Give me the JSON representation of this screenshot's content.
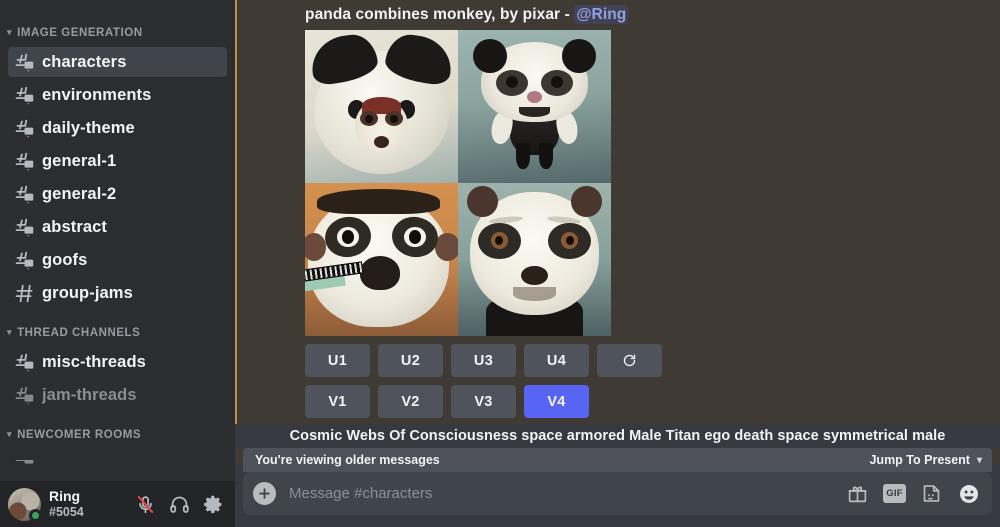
{
  "sidebar": {
    "categories": [
      {
        "label": "IMAGE GENERATION",
        "channels": [
          {
            "name": "characters",
            "icon": "forum-hash-icon",
            "state": "active"
          },
          {
            "name": "environments",
            "icon": "forum-hash-icon",
            "state": "unread"
          },
          {
            "name": "daily-theme",
            "icon": "forum-hash-icon",
            "state": "unread"
          },
          {
            "name": "general-1",
            "icon": "forum-hash-icon",
            "state": "unread"
          },
          {
            "name": "general-2",
            "icon": "forum-hash-icon",
            "state": "unread"
          },
          {
            "name": "abstract",
            "icon": "forum-hash-icon",
            "state": "unread"
          },
          {
            "name": "goofs",
            "icon": "forum-hash-icon",
            "state": "unread"
          },
          {
            "name": "group-jams",
            "icon": "hash-icon",
            "state": "unread"
          }
        ]
      },
      {
        "label": "THREAD CHANNELS",
        "channels": [
          {
            "name": "misc-threads",
            "icon": "forum-hash-icon",
            "state": "unread"
          },
          {
            "name": "jam-threads",
            "icon": "forum-hash-icon",
            "state": "dim"
          }
        ]
      },
      {
        "label": "NEWCOMER ROOMS",
        "channels": []
      }
    ],
    "user": {
      "name": "Ring",
      "tag": "#5054",
      "status": "online",
      "controls": [
        {
          "icon": "microphone-muted-icon",
          "label": "Mute"
        },
        {
          "icon": "headphones-icon",
          "label": "Deafen"
        },
        {
          "icon": "gear-icon",
          "label": "User Settings"
        }
      ]
    }
  },
  "message": {
    "prompt_title": "panda combines monkey, by pixar",
    "separator": "-",
    "mention": "@Ring",
    "image_grid": {
      "rows": 2,
      "cols": 2,
      "tiles": [
        {
          "position": "top-left",
          "alt": "cream background panda head with small monkey face"
        },
        {
          "position": "top-right",
          "alt": "teal background standing panda character"
        },
        {
          "position": "bottom-left",
          "alt": "orange background panda face with harmonica"
        },
        {
          "position": "bottom-right",
          "alt": "teal background panda face close-up"
        }
      ]
    },
    "upscale_buttons": [
      {
        "label": "U1",
        "selected": false
      },
      {
        "label": "U2",
        "selected": false
      },
      {
        "label": "U3",
        "selected": false
      },
      {
        "label": "U4",
        "selected": false
      }
    ],
    "reroll_button": {
      "icon": "refresh-icon",
      "label": ""
    },
    "variation_buttons": [
      {
        "label": "V1",
        "selected": false
      },
      {
        "label": "V2",
        "selected": false
      },
      {
        "label": "V3",
        "selected": false
      },
      {
        "label": "V4",
        "selected": true
      }
    ]
  },
  "next_prompt": {
    "text": "Cosmic Webs Of Consciousness space armored Male Titan ego death space symmetrical male"
  },
  "older_messages_bar": {
    "text": "You're viewing older messages",
    "jump_label": "Jump To Present",
    "chevron": "chevron-down-icon"
  },
  "composer": {
    "add_icon": "plus-circle-icon",
    "placeholder": "Message #characters",
    "value": "",
    "actions": [
      {
        "icon": "gift-icon",
        "label": ""
      },
      {
        "icon": "gif-icon",
        "label": "GIF"
      },
      {
        "icon": "sticker-icon",
        "label": ""
      },
      {
        "icon": "emoji-icon",
        "label": ""
      }
    ]
  },
  "colors": {
    "sidebar_bg": "#2b2d31",
    "userbar_bg": "#232428",
    "main_bg": "#3f3a33",
    "mention_bar": "#c08f4a",
    "accent_blurple": "#5865f2",
    "button_bg": "#4f545c",
    "composer_bg": "#40444b",
    "status_online": "#3ba55d"
  }
}
